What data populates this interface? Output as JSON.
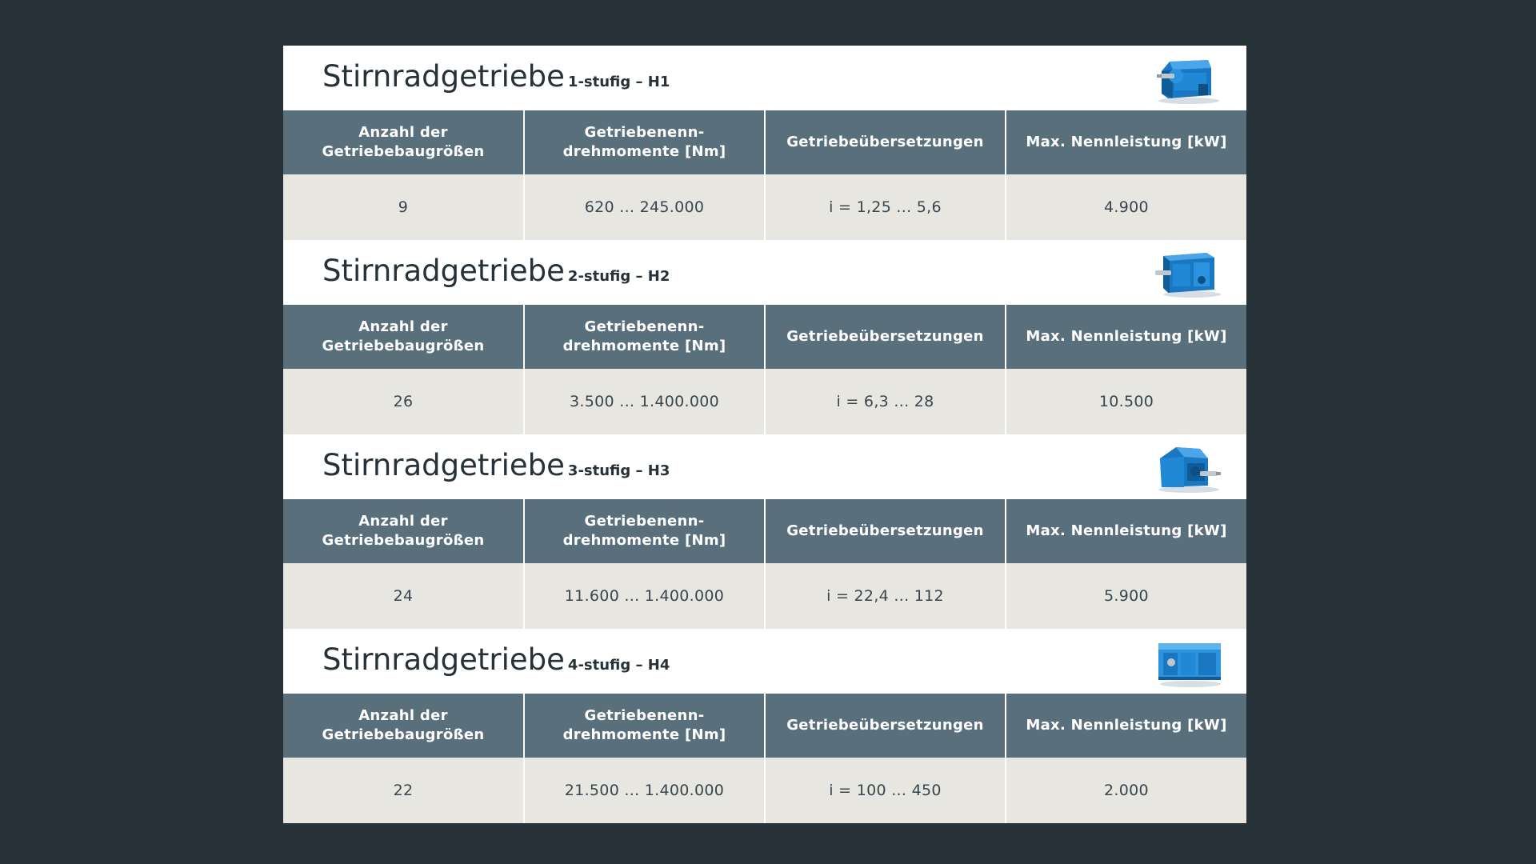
{
  "colors": {
    "background": "#263238",
    "header_bg": "#59707c",
    "row_bg": "#e7e6e0",
    "gear_blue": "#1a78c2"
  },
  "headers": {
    "col1_line1": "Anzahl der",
    "col1_line2": "Getriebebaugrößen",
    "col2_line1": "Getriebenenn-",
    "col2_line2": "drehmomente [Nm]",
    "col3": "Getriebeübersetzungen",
    "col4": "Max. Nennleistung [kW]"
  },
  "sections": [
    {
      "title": "Stirnradgetriebe",
      "subtitle": "1-stufig – H1",
      "icon": "gearbox-h1-image",
      "sizes": "9",
      "torque": "620 ... 245.000",
      "ratios": "i = 1,25 ... 5,6",
      "power": "4.900"
    },
    {
      "title": "Stirnradgetriebe",
      "subtitle": "2-stufig – H2",
      "icon": "gearbox-h2-image",
      "sizes": "26",
      "torque": "3.500 ... 1.400.000",
      "ratios": "i = 6,3 ... 28",
      "power": "10.500"
    },
    {
      "title": "Stirnradgetriebe",
      "subtitle": "3-stufig – H3",
      "icon": "gearbox-h3-image",
      "sizes": "24",
      "torque": "11.600 ... 1.400.000",
      "ratios": "i = 22,4 ... 112",
      "power": "5.900"
    },
    {
      "title": "Stirnradgetriebe",
      "subtitle": "4-stufig – H4",
      "icon": "gearbox-h4-image",
      "sizes": "22",
      "torque": "21.500 ... 1.400.000",
      "ratios": "i = 100 ... 450",
      "power": "2.000"
    }
  ]
}
